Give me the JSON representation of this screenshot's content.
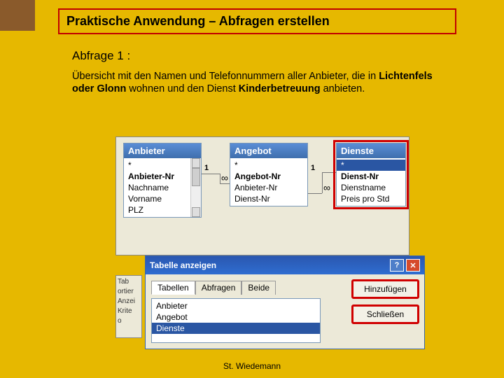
{
  "title": "Praktische Anwendung – Abfragen erstellen",
  "heading": "Abfrage 1 :",
  "para": {
    "p1": "Übersicht mit den Namen und Telefonnummern aller Anbieter, die in ",
    "p2": "Lichtenfels oder Glonn",
    "p3": " wohnen und den Dienst ",
    "p4": "Kinderbetreuung",
    "p5": " anbieten."
  },
  "tables": {
    "anbieter": {
      "title": "Anbieter",
      "fields": [
        "*",
        "Anbieter-Nr",
        "Nachname",
        "Vorname",
        "PLZ"
      ]
    },
    "angebot": {
      "title": "Angebot",
      "fields": [
        "*",
        "Angebot-Nr",
        "Anbieter-Nr",
        "Dienst-Nr"
      ]
    },
    "dienste": {
      "title": "Dienste",
      "fields": [
        "*",
        "Dienst-Nr",
        "Dienstname",
        "Preis pro Std"
      ]
    }
  },
  "link_one": "1",
  "link_inf": "∞",
  "grid_labels": {
    "r1": "Tab",
    "r2": "ortier",
    "r3": "Anzei",
    "r4": "Krite",
    "r5": "o"
  },
  "dialog": {
    "title": "Tabelle anzeigen",
    "tabs": {
      "t1": "Tabellen",
      "t2": "Abfragen",
      "t3": "Beide"
    },
    "items": {
      "i1": "Anbieter",
      "i2": "Angebot",
      "i3": "Dienste"
    },
    "btn_add": "Hinzufügen",
    "btn_close": "Schließen",
    "help_glyph": "?",
    "close_glyph": "✕"
  },
  "footer": "St. Wiedemann"
}
